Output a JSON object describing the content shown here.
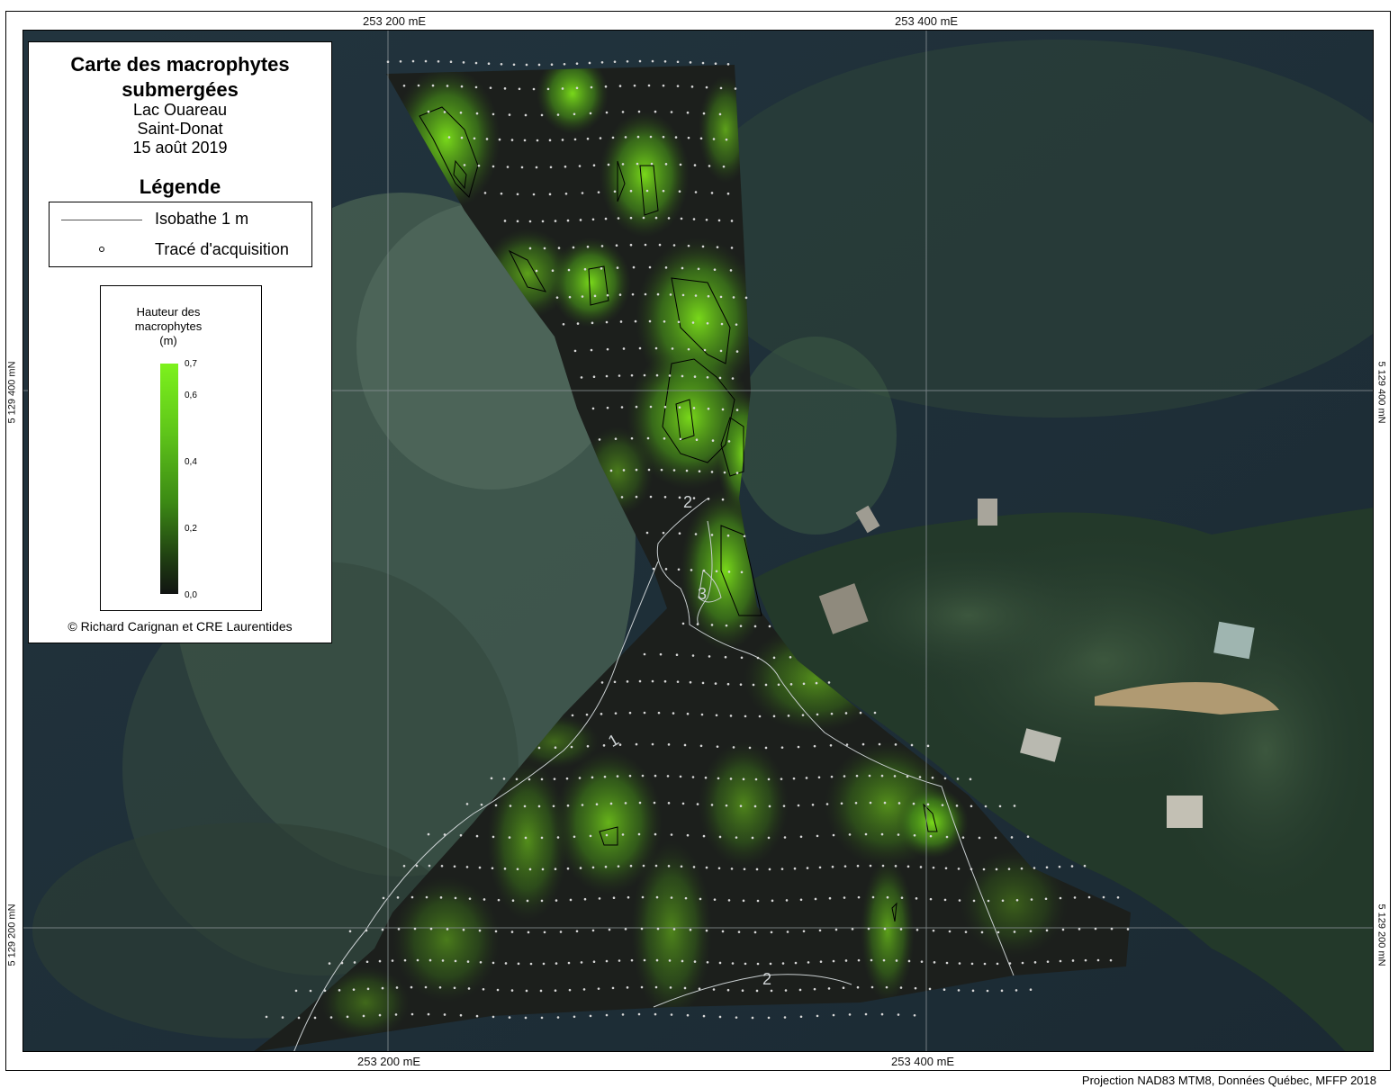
{
  "map": {
    "title_line1": "Carte des macrophytes",
    "title_line2": "submergées",
    "lake": "Lac Ouareau",
    "town": "Saint-Donat",
    "date": "15 août 2019"
  },
  "legend": {
    "heading": "Légende",
    "isobath_label": "Isobathe 1 m",
    "track_label": "Tracé d'acquisition",
    "ramp_title_l1": "Hauteur des",
    "ramp_title_l2": "macrophytes",
    "ramp_title_l3": "(m)",
    "ramp_ticks": [
      "0,7",
      "0,6",
      "0,4",
      "0,2",
      "0,0"
    ],
    "ramp_colors": [
      "#7df21c",
      "#111412"
    ]
  },
  "credit": "© Richard Carignan et CRE Laurentides",
  "projection": "Projection NAD83 MTM8, Données Québec, MFFP 2018",
  "grid": {
    "east_1": "253 200 mE",
    "east_2": "253 400 mE",
    "north_1": "5 129 400 mN",
    "north_2": "5 129 200 mN"
  },
  "isobath_labels": [
    "1",
    "2",
    "2",
    "3"
  ]
}
